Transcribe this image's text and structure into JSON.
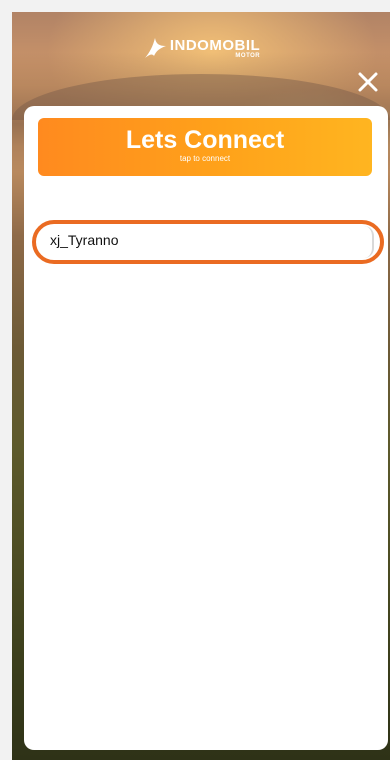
{
  "brand": {
    "name": "INDOMOBIL",
    "sub": "MOTOR"
  },
  "close_icon": "close-icon",
  "connect": {
    "title": "Lets Connect",
    "subtitle": "tap to connect"
  },
  "devices": [
    {
      "name": "xj_Tyranno"
    }
  ],
  "colors": {
    "accent_orange": "#ffa21a",
    "highlight_ring": "#ea6b22",
    "panel_bg": "#ffffff"
  }
}
